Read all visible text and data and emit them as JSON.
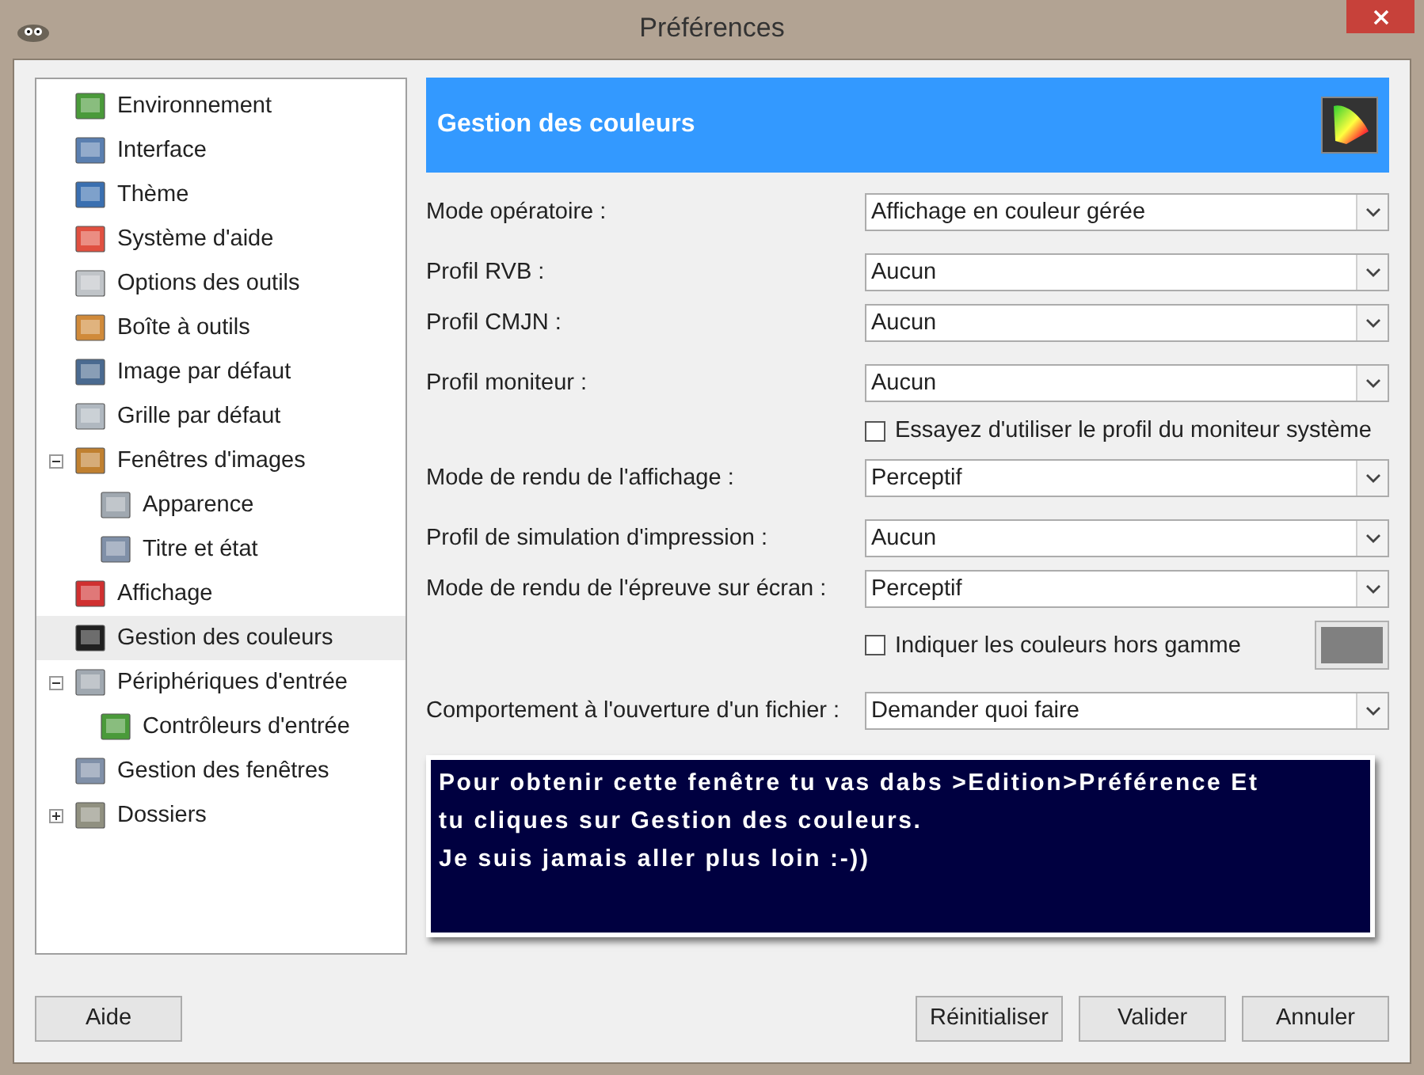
{
  "window": {
    "title": "Préférences"
  },
  "sidebar": {
    "items": [
      {
        "label": "Environnement",
        "selected": false
      },
      {
        "label": "Interface",
        "selected": false
      },
      {
        "label": "Thème",
        "selected": false
      },
      {
        "label": "Système d'aide",
        "selected": false
      },
      {
        "label": "Options des outils",
        "selected": false
      },
      {
        "label": "Boîte à outils",
        "selected": false
      },
      {
        "label": "Image par défaut",
        "selected": false
      },
      {
        "label": "Grille par défaut",
        "selected": false
      },
      {
        "label": "Fenêtres d'images",
        "selected": false,
        "expanded": true,
        "children": [
          {
            "label": "Apparence",
            "selected": false
          },
          {
            "label": "Titre et état",
            "selected": false
          }
        ]
      },
      {
        "label": "Affichage",
        "selected": false
      },
      {
        "label": "Gestion des couleurs",
        "selected": true
      },
      {
        "label": "Périphériques d'entrée",
        "selected": false,
        "expanded": true,
        "children": [
          {
            "label": "Contrôleurs d'entrée",
            "selected": false
          }
        ]
      },
      {
        "label": "Gestion des fenêtres",
        "selected": false
      },
      {
        "label": "Dossiers",
        "selected": false,
        "expanded": false
      }
    ]
  },
  "panel": {
    "title": "Gestion des couleurs",
    "rows": [
      {
        "kind": "combo",
        "label": "Mode opératoire :",
        "value": "Affichage en couleur gérée"
      },
      {
        "kind": "combo",
        "label": "Profil RVB :",
        "value": "Aucun"
      },
      {
        "kind": "combo",
        "label": "Profil CMJN :",
        "value": "Aucun"
      },
      {
        "kind": "combo",
        "label": "Profil moniteur :",
        "value": "Aucun"
      },
      {
        "kind": "checkbox",
        "label": "Essayez d'utiliser le profil du moniteur système",
        "checked": false
      },
      {
        "kind": "combo",
        "label": "Mode de rendu de l'affichage :",
        "value": "Perceptif"
      },
      {
        "kind": "combo",
        "label": "Profil de simulation d'impression :",
        "value": "Aucun"
      },
      {
        "kind": "combo",
        "label": "Mode de rendu de l'épreuve sur écran :",
        "value": "Perceptif"
      },
      {
        "kind": "checkbox_swatch",
        "label": "Indiquer les couleurs hors gamme",
        "checked": false
      },
      {
        "kind": "combo",
        "label": "Comportement à l'ouverture d'un fichier :",
        "value": "Demander quoi faire"
      }
    ]
  },
  "note": {
    "lines": [
      "Pour obtenir cette fenêtre tu vas dabs >Edition>Préférence Et",
      "tu cliques sur Gestion des couleurs.",
      "Je suis jamais aller plus loin :-))"
    ]
  },
  "buttons": {
    "left": [
      "Aide"
    ],
    "right": [
      "Réinitialiser",
      "Valider",
      "Annuler"
    ]
  }
}
